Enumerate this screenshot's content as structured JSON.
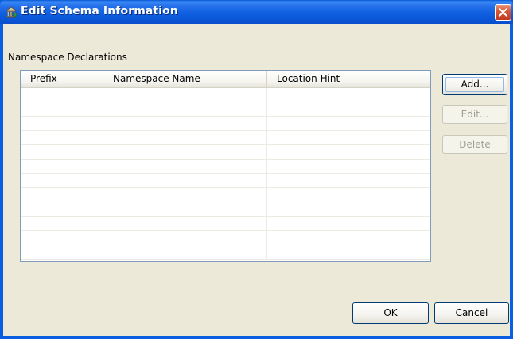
{
  "window": {
    "title": "Edit Schema Information",
    "icons": {
      "app": "schema-icon",
      "close": "close-icon"
    },
    "colors": {
      "titlebar": "#0a5ee0",
      "client_bg": "#ece9d8",
      "close_button": "#d8583a"
    }
  },
  "namespace_section": {
    "label": "Namespace Declarations",
    "columns": [
      "Prefix",
      "Namespace Name",
      "Location Hint"
    ],
    "rows": []
  },
  "side_buttons": {
    "add": "Add...",
    "edit": "Edit...",
    "delete": "Delete"
  },
  "footer_buttons": {
    "ok": "OK",
    "cancel": "Cancel"
  }
}
